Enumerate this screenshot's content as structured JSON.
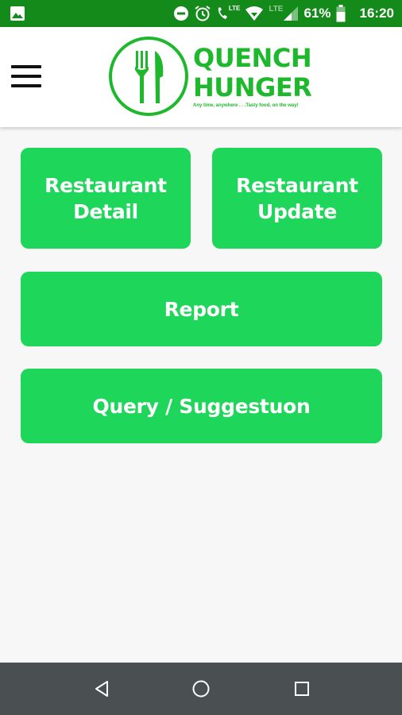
{
  "status_bar": {
    "lte_small": "LTE",
    "lte_dim": "LTE",
    "battery": "61%",
    "time": "16:20",
    "icons": [
      "gallery-icon",
      "do-not-disturb-icon",
      "alarm-icon",
      "volte-call-icon",
      "wifi-icon",
      "signal-icon",
      "battery-icon"
    ]
  },
  "app_bar": {
    "logo_line1": "QUENCH",
    "logo_line2": "HUNGER",
    "logo_tagline": "Any time, anywhere . . .Tasty food, on the way!",
    "menu_icon": "hamburger-menu-icon"
  },
  "buttons": {
    "restaurant_detail": {
      "line1": "Restaurant",
      "line2": "Detail"
    },
    "restaurant_update": {
      "line1": "Restaurant",
      "line2": "Update"
    },
    "report": "Report",
    "query": "Query / Suggestuon"
  },
  "colors": {
    "status_bar": "#138a1a",
    "brand_green": "#1db82b",
    "button_green": "#1ed65a",
    "nav_bar": "#4a4f52"
  },
  "nav_bar": {
    "icons": [
      "back-icon",
      "home-icon",
      "recents-icon"
    ]
  }
}
